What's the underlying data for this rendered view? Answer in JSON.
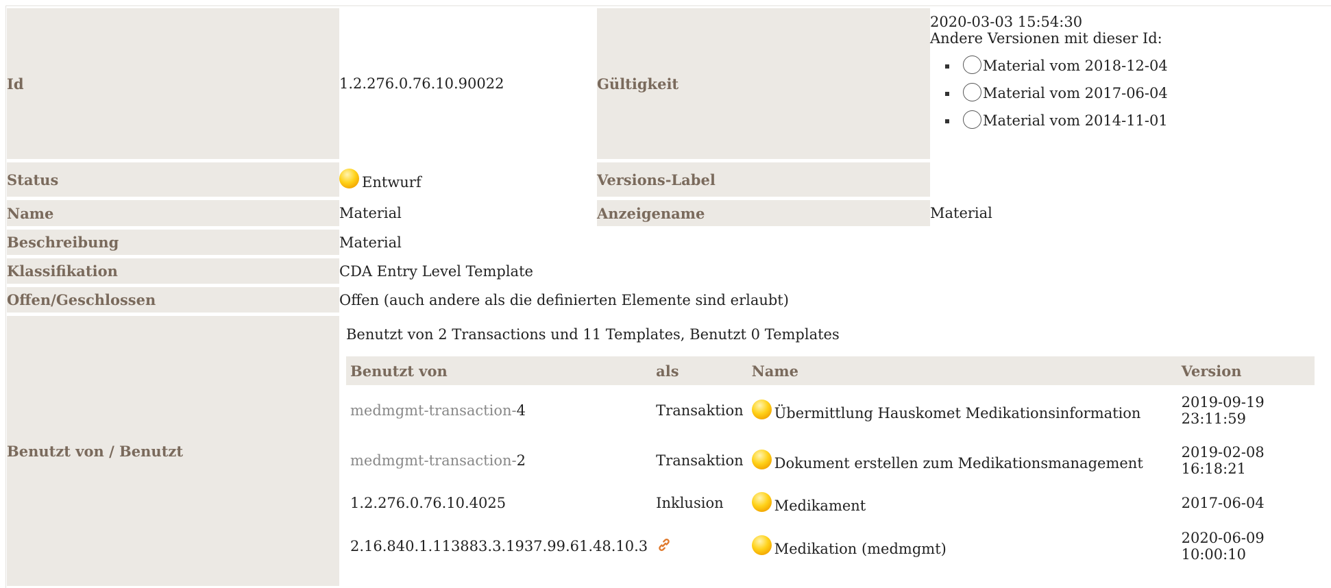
{
  "id": {
    "label": "Id",
    "value": "1.2.276.0.76.10.90022"
  },
  "validity": {
    "label": "Gültigkeit",
    "date": "2020-03-03 15:54:30",
    "other_versions_label": "Andere Versionen mit dieser Id:",
    "versions": [
      "Material vom 2018-12-04",
      "Material vom 2017-06-04",
      "Material vom 2014-11-01"
    ]
  },
  "status": {
    "label": "Status",
    "value": "Entwurf",
    "color": "#ffd21a"
  },
  "version_label": {
    "label": "Versions-Label",
    "value": ""
  },
  "name": {
    "label": "Name",
    "value": "Material"
  },
  "display_name": {
    "label": "Anzeigename",
    "value": "Material"
  },
  "description": {
    "label": "Beschreibung",
    "value": "Material"
  },
  "classification": {
    "label": "Klassifikation",
    "value": "CDA Entry Level Template"
  },
  "open_closed": {
    "label": "Offen/Geschlossen",
    "value": "Offen (auch andere als die definierten Elemente sind erlaubt)"
  },
  "usage": {
    "label": "Benutzt von / Benutzt",
    "summary": "Benutzt von 2 Transactions und 11 Templates, Benutzt 0 Templates",
    "columns": [
      "Benutzt von",
      "als",
      "Name",
      "Version"
    ],
    "rows": [
      {
        "ref_prefix": "medmgmt-transaction-",
        "ref_suffix": "4",
        "as": "Transaktion",
        "name": "Übermittlung Hauskomet Medikationsinformation",
        "version_date": "2019-09-19",
        "version_time": "23:11:59"
      },
      {
        "ref_prefix": "medmgmt-transaction-",
        "ref_suffix": "2",
        "as": "Transaktion",
        "name": "Dokument erstellen zum Medikationsmanagement",
        "version_date": "2019-02-08",
        "version_time": "16:18:21"
      },
      {
        "ref_prefix": "",
        "ref_suffix": "1.2.276.0.76.10.4025",
        "as": "Inklusion",
        "name": "Medikament",
        "version_date": "2017-06-04",
        "version_time": ""
      },
      {
        "ref_prefix": "",
        "ref_suffix": "2.16.840.1.113883.3.1937.99.61.48.10.3",
        "as": "",
        "as_icon": "link-icon",
        "name": "Medikation (medmgmt)",
        "version_date": "2020-06-09",
        "version_time": "10:00:10"
      }
    ]
  }
}
